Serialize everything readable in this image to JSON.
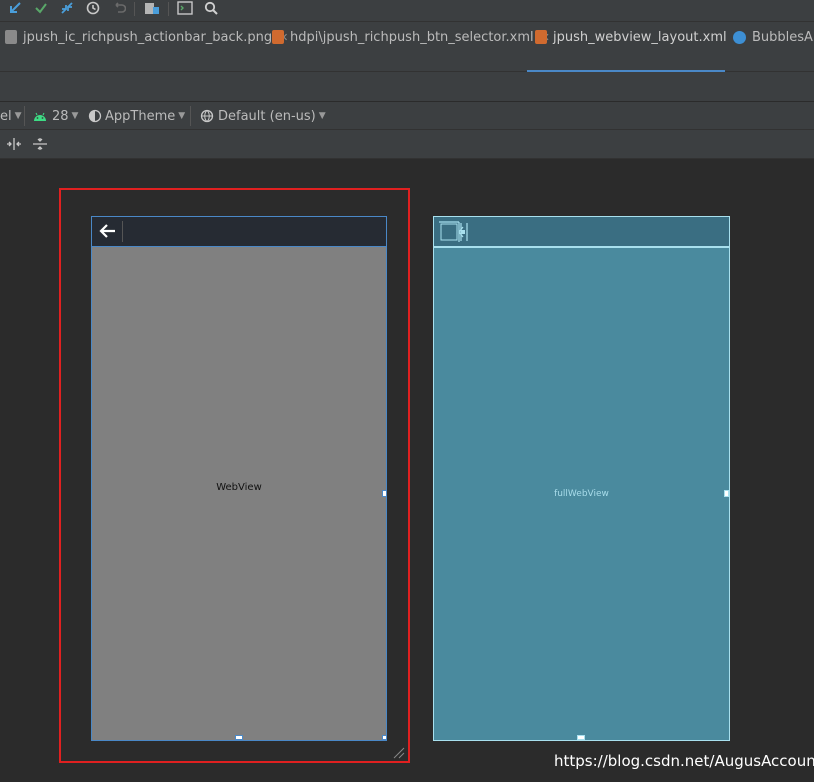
{
  "toolbar": {
    "icons": [
      "update-project-icon",
      "commit-icon",
      "merge-icon",
      "history-icon",
      "revert-icon",
      "project-structure-icon",
      "terminal-icon",
      "search-icon"
    ]
  },
  "tabs": [
    {
      "label": "jpush_ic_richpush_actionbar_back.png",
      "icon": "png-file-icon",
      "active": false
    },
    {
      "label": "hdpi\\jpush_richpush_btn_selector.xml",
      "icon": "xml-file-icon",
      "active": false
    },
    {
      "label": "jpush_webview_layout.xml",
      "icon": "layout-file-icon",
      "active": true
    },
    {
      "label": "BubblesAn",
      "icon": "class-file-icon",
      "active": false
    }
  ],
  "config": {
    "device_label": "el",
    "api_level": "28",
    "theme": "AppTheme",
    "locale": "Default (en-us)"
  },
  "design": {
    "webview_label": "WebView"
  },
  "blueprint": {
    "webview_label": "fullWebView"
  },
  "watermark": "https://blog.csdn.net/AugusAccount",
  "colors": {
    "accent": "#4a88c7",
    "selection_frame": "#e02020",
    "blueprint_bg": "#4a8a9e",
    "android_green": "#3ddc84"
  }
}
